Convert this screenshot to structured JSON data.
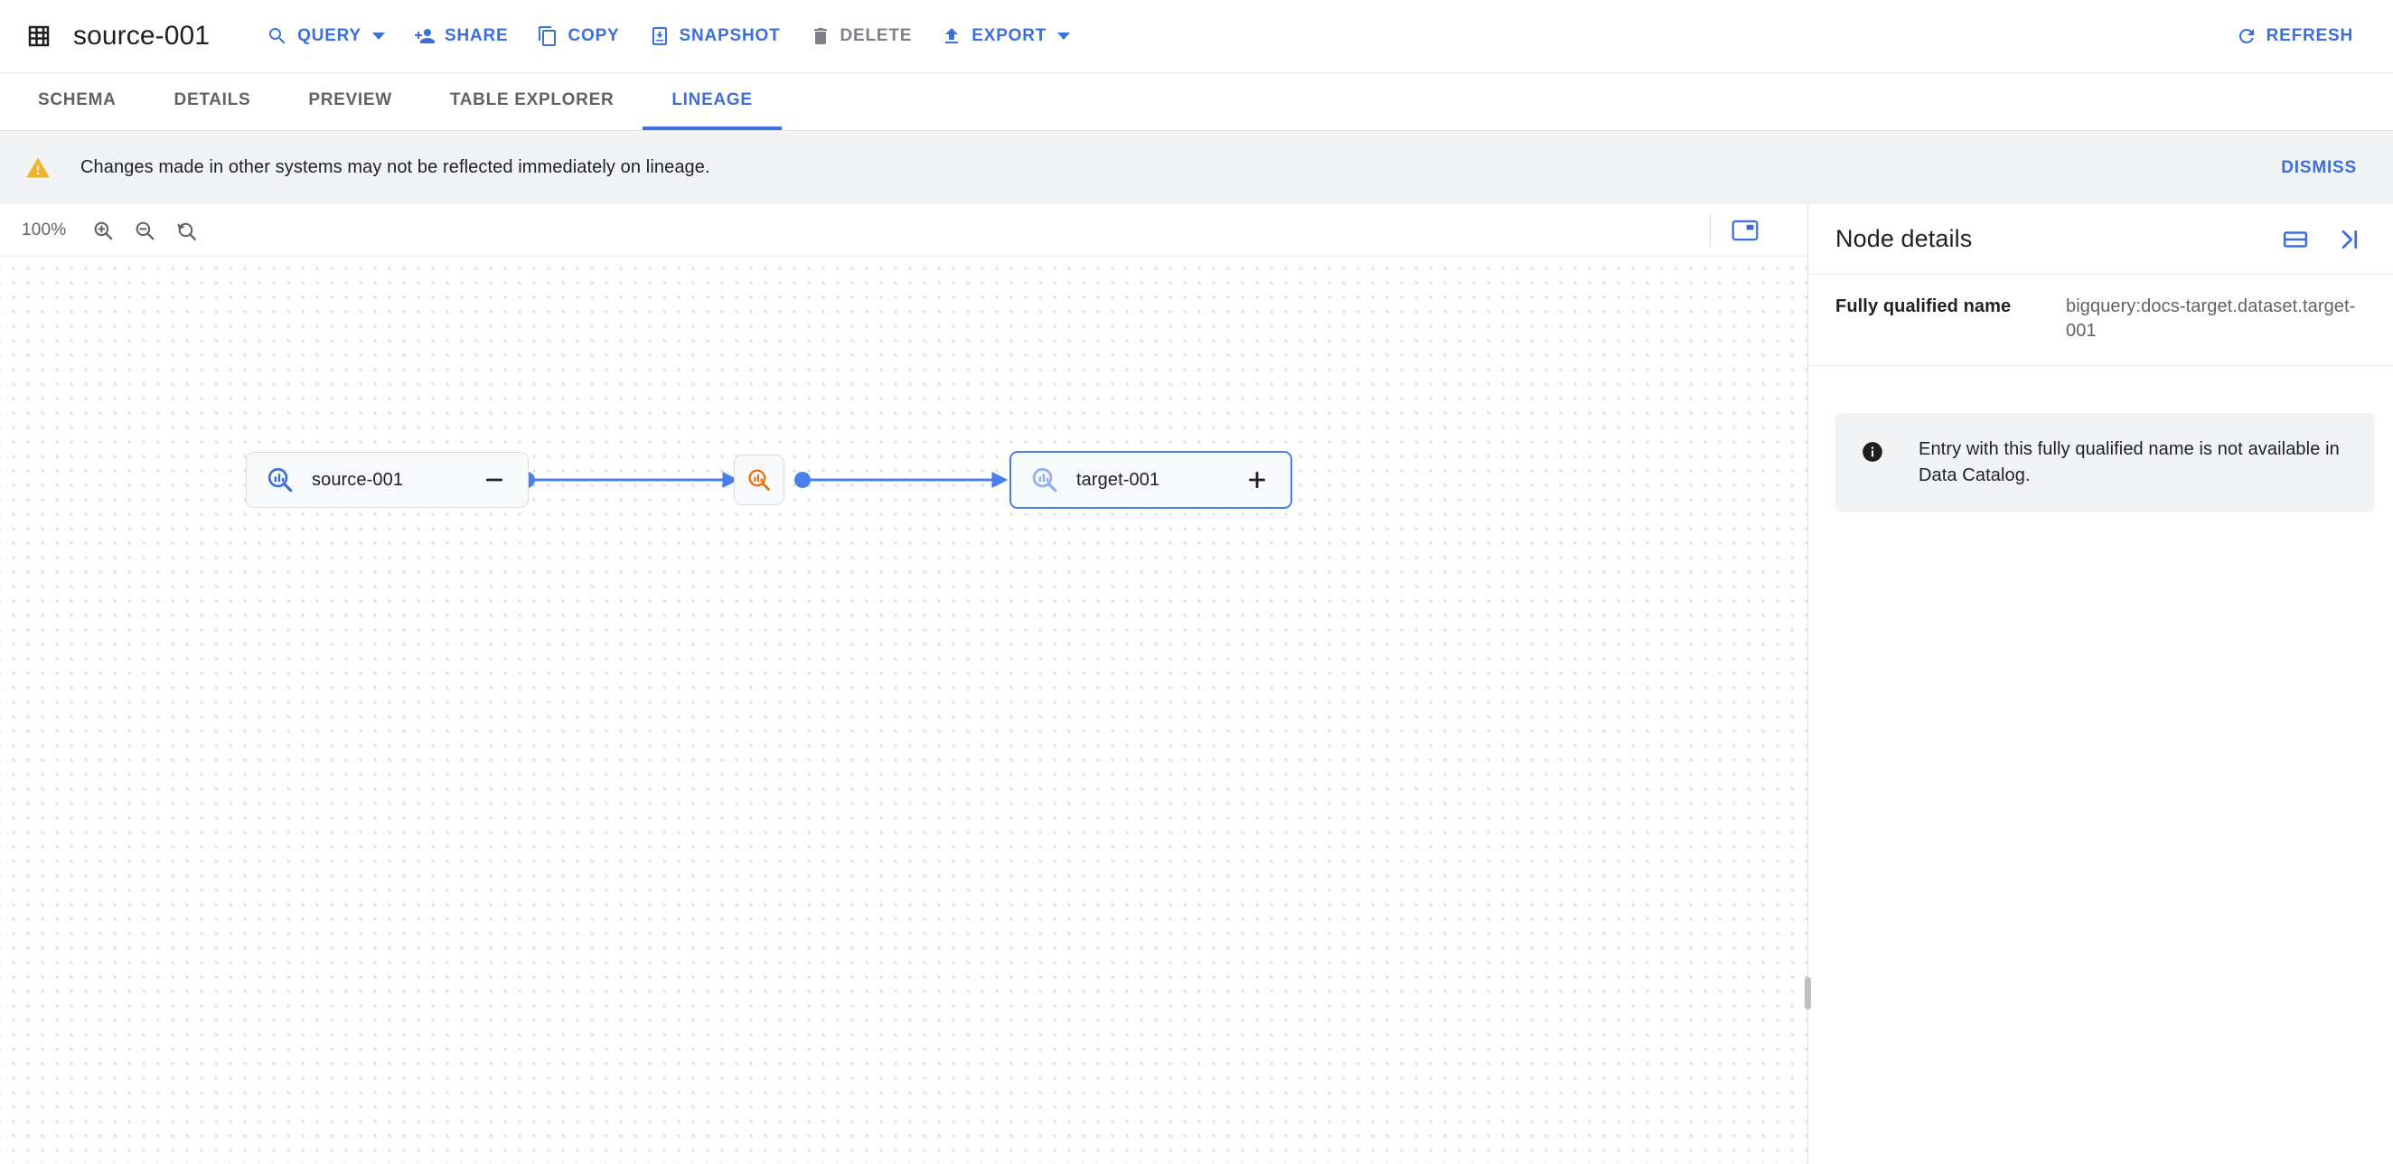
{
  "header": {
    "title": "source-001",
    "table_icon": "table-icon",
    "actions": [
      {
        "id": "query",
        "label": "QUERY",
        "icon": "search-icon",
        "has_caret": true,
        "disabled": false
      },
      {
        "id": "share",
        "label": "SHARE",
        "icon": "person-add-icon",
        "has_caret": false,
        "disabled": false
      },
      {
        "id": "copy",
        "label": "COPY",
        "icon": "copy-icon",
        "has_caret": false,
        "disabled": false
      },
      {
        "id": "snapshot",
        "label": "SNAPSHOT",
        "icon": "snapshot-icon",
        "has_caret": false,
        "disabled": false
      },
      {
        "id": "delete",
        "label": "DELETE",
        "icon": "trash-icon",
        "has_caret": false,
        "disabled": true
      },
      {
        "id": "export",
        "label": "EXPORT",
        "icon": "upload-icon",
        "has_caret": true,
        "disabled": false
      }
    ],
    "refresh": {
      "label": "REFRESH",
      "icon": "refresh-icon"
    }
  },
  "tabs": {
    "active": "LINEAGE",
    "items": [
      {
        "label": "SCHEMA"
      },
      {
        "label": "DETAILS"
      },
      {
        "label": "PREVIEW"
      },
      {
        "label": "TABLE EXPLORER"
      },
      {
        "label": "LINEAGE"
      }
    ]
  },
  "banner": {
    "icon": "warning-icon",
    "message": "Changes made in other systems may not be reflected immediately on lineage.",
    "dismiss_label": "DISMISS"
  },
  "canvas_toolbar": {
    "zoom_level": "100%",
    "zoom_in_icon": "zoom-in-icon",
    "zoom_out_icon": "zoom-out-icon",
    "zoom_reset_icon": "zoom-reset-icon",
    "minimap_icon": "minimap-icon"
  },
  "graph": {
    "nodes": [
      {
        "id": "source",
        "label": "source-001",
        "icon": "bigquery-search-icon",
        "icon_color": "#3c6fdb",
        "toggle": "minus",
        "selected": false
      },
      {
        "id": "process",
        "label": "",
        "icon": "process-search-icon",
        "icon_color": "#e8710a",
        "toggle": "",
        "selected": false
      },
      {
        "id": "target",
        "label": "target-001",
        "icon": "bigquery-search-icon",
        "icon_color": "#8ab0f0",
        "toggle": "plus",
        "selected": true
      }
    ],
    "edges": [
      {
        "from": "source",
        "to": "process"
      },
      {
        "from": "process",
        "to": "target"
      }
    ],
    "edge_color": "#4a7ee8"
  },
  "panel": {
    "title": "Node details",
    "layout_icon": "split-layout-icon",
    "collapse_icon": "collapse-right-icon",
    "properties": [
      {
        "key": "Fully qualified name",
        "value": "bigquery:docs-target.dataset.target-001"
      }
    ],
    "info": {
      "icon": "info-icon",
      "message": "Entry with this fully qualified name is not available in Data Catalog."
    }
  }
}
